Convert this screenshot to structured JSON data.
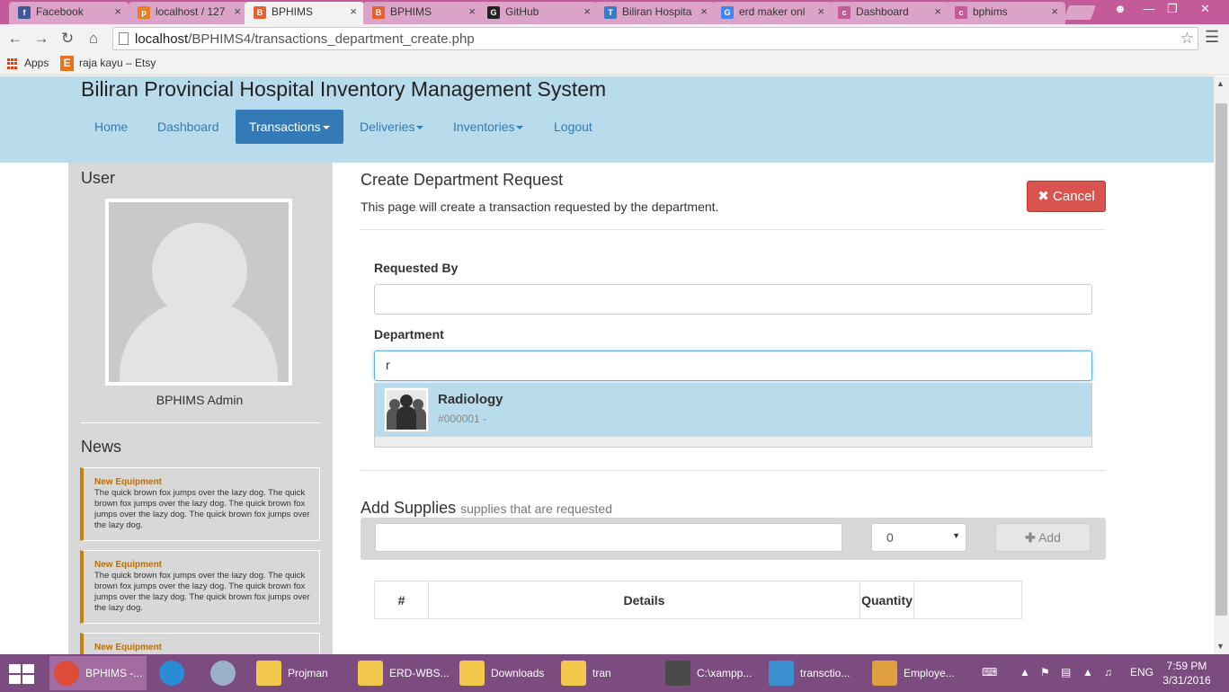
{
  "browser": {
    "tabs": [
      {
        "title": "Facebook",
        "icon": "facebook-icon",
        "color": "#3b5998",
        "glyph": "f"
      },
      {
        "title": "localhost / 127",
        "icon": "phpmyadmin-icon",
        "color": "#e67e22",
        "glyph": "p"
      },
      {
        "title": "BPHIMS",
        "icon": "bphims-icon",
        "color": "#e8612c",
        "glyph": "B"
      },
      {
        "title": "BPHIMS",
        "icon": "bphims-icon",
        "color": "#e8612c",
        "glyph": "B"
      },
      {
        "title": "GitHub",
        "icon": "github-icon",
        "color": "#222222",
        "glyph": "G"
      },
      {
        "title": "Biliran Hospita",
        "icon": "trello-icon",
        "color": "#3a7cc2",
        "glyph": "T"
      },
      {
        "title": "erd maker onl",
        "icon": "google-icon",
        "color": "#4285f4",
        "glyph": "G"
      },
      {
        "title": "Dashboard",
        "icon": "cloud-icon",
        "color": "#c55a9a",
        "glyph": "c"
      },
      {
        "title": "bphims",
        "icon": "cloud-icon",
        "color": "#c55a9a",
        "glyph": "c"
      }
    ],
    "active_tab": 2,
    "url_host": "localhost",
    "url_path": "/BPHIMS4/transactions_department_create.php",
    "bookmarks": {
      "apps": "Apps",
      "etsy": "raja kayu – Etsy"
    }
  },
  "site": {
    "title": "Biliran Provincial Hospital Inventory Management System",
    "nav": [
      {
        "label": "Home",
        "dropdown": false
      },
      {
        "label": "Dashboard",
        "dropdown": false
      },
      {
        "label": "Transactions",
        "dropdown": true
      },
      {
        "label": "Deliveries",
        "dropdown": true
      },
      {
        "label": "Inventories",
        "dropdown": true
      },
      {
        "label": "Logout",
        "dropdown": false
      }
    ]
  },
  "sidebar": {
    "user_heading": "User",
    "user_name": "BPHIMS Admin",
    "news_heading": "News",
    "news": [
      {
        "title": "New Equipment",
        "body": "The quick brown fox jumps over the lazy dog. The quick brown fox jumps over the lazy dog. The quick brown fox jumps over the lazy dog. The quick brown fox jumps over the lazy dog."
      },
      {
        "title": "New Equipment",
        "body": "The quick brown fox jumps over the lazy dog. The quick brown fox jumps over the lazy dog. The quick brown fox jumps over the lazy dog. The quick brown fox jumps over the lazy dog."
      },
      {
        "title": "New Equipment",
        "body": ""
      }
    ]
  },
  "main": {
    "title": "Create Department Request",
    "description": "This page will create a transaction requested by the department.",
    "cancel_label": "Cancel",
    "requested_by_label": "Requested By",
    "requested_by_value": "",
    "department_label": "Department",
    "department_value": "r",
    "suggestion": {
      "name": "Radiology",
      "code": "#000001 -"
    },
    "supplies_heading": "Add Supplies",
    "supplies_sub": "supplies that are requested",
    "supply_input_value": "",
    "quantity_selected": "0",
    "add_label": "Add",
    "table_headers": [
      "#",
      "Details",
      "Quantity",
      ""
    ]
  },
  "taskbar": {
    "items": [
      {
        "label": "BPHIMS -...",
        "icon": "chrome-icon",
        "color": "#dd4b39",
        "active": true
      },
      {
        "label": "Projman",
        "icon": "folder-icon",
        "color": "#f2c94c",
        "active": false
      },
      {
        "label": "ERD-WBS...",
        "icon": "folder-icon",
        "color": "#f2c94c",
        "active": false
      },
      {
        "label": "Downloads",
        "icon": "downloads-folder-icon",
        "color": "#f2c94c",
        "active": false
      },
      {
        "label": "tran",
        "icon": "folder-icon",
        "color": "#f2c94c",
        "active": false
      },
      {
        "label": "C:\\xampp...",
        "icon": "sublime-icon",
        "color": "#4a4a4a",
        "active": false
      },
      {
        "label": "transctio...",
        "icon": "photo-viewer-icon",
        "color": "#3a8fd0",
        "active": false
      },
      {
        "label": "Employe...",
        "icon": "paint-icon",
        "color": "#e0a040",
        "active": false
      }
    ],
    "language": "ENG",
    "time": "7:59 PM",
    "date": "3/31/2016"
  }
}
